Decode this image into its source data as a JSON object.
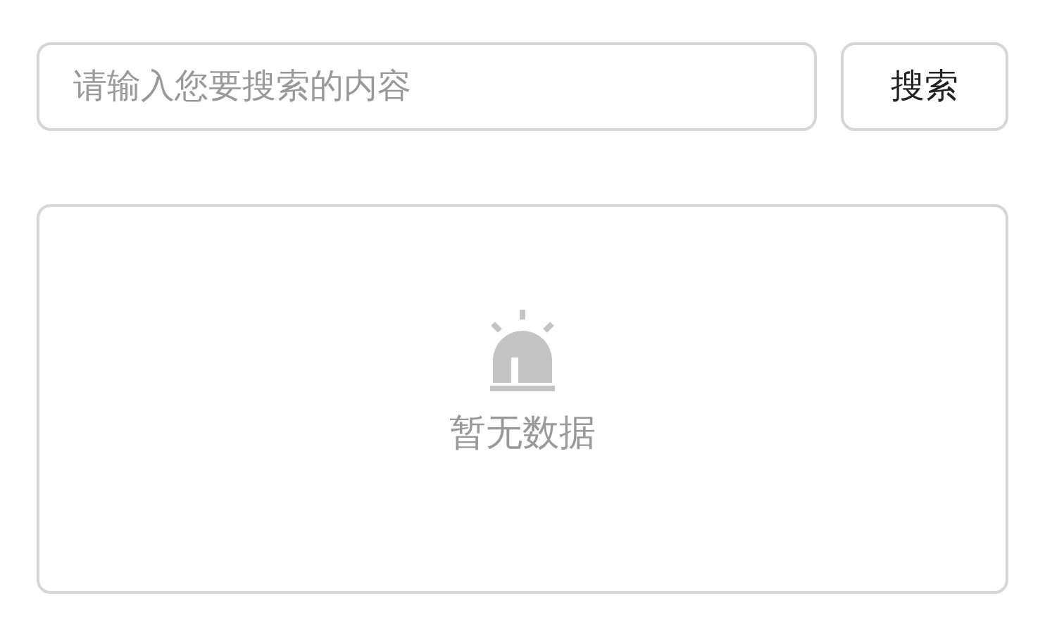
{
  "search": {
    "placeholder": "请输入您要搜索的内容",
    "button": "搜索"
  },
  "empty_state": {
    "message": "暂无数据"
  }
}
